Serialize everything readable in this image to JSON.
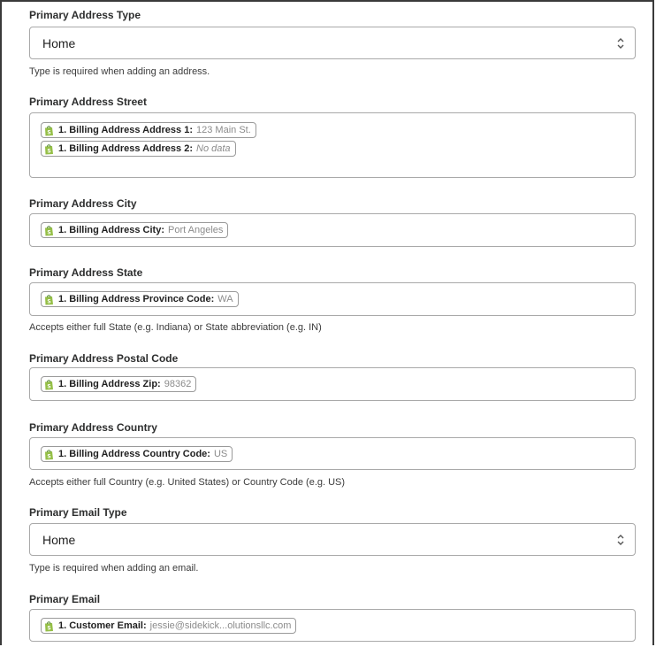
{
  "icons": {
    "app_icon": "shopify-bag-icon",
    "select_icon": "chevron-up-down-icon"
  },
  "colors": {
    "app_icon_green": "#95bf47",
    "pill_value_gray": "#8b8b8b"
  },
  "fields": {
    "address_type": {
      "label": "Primary Address Type",
      "value": "Home",
      "help": "Type is required when adding an address."
    },
    "street": {
      "label": "Primary Address Street",
      "pills": [
        {
          "key": "1. Billing Address Address 1:",
          "value": "123 Main St."
        },
        {
          "key": "1. Billing Address Address 2:",
          "value": "No data"
        }
      ]
    },
    "city": {
      "label": "Primary Address City",
      "pill": {
        "key": "1. Billing Address City:",
        "value": "Port Angeles"
      }
    },
    "state": {
      "label": "Primary Address State",
      "pill": {
        "key": "1. Billing Address Province Code:",
        "value": "WA"
      },
      "help": "Accepts either full State (e.g. Indiana) or State abbreviation (e.g. IN)"
    },
    "postal": {
      "label": "Primary Address Postal Code",
      "pill": {
        "key": "1. Billing Address Zip:",
        "value": "98362"
      }
    },
    "country": {
      "label": "Primary Address Country",
      "pill": {
        "key": "1. Billing Address Country Code:",
        "value": "US"
      },
      "help": "Accepts either full Country (e.g. United States) or Country Code (e.g. US)"
    },
    "email_type": {
      "label": "Primary Email Type",
      "value": "Home",
      "help": "Type is required when adding an email."
    },
    "email": {
      "label": "Primary Email",
      "pill": {
        "key": "1. Customer Email:",
        "value": "jessie@sidekick...olutionsllc.com"
      }
    }
  }
}
